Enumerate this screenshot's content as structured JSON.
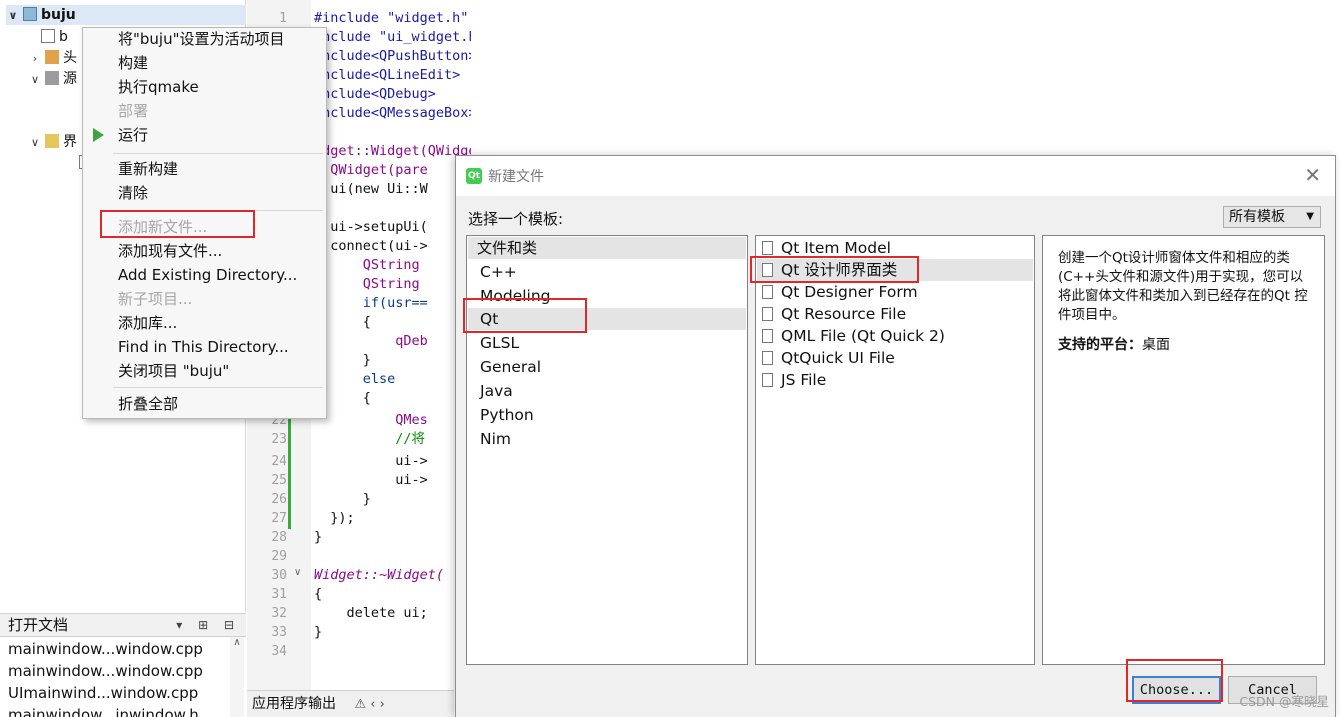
{
  "tree": {
    "root": "buju",
    "rows": [
      "b",
      "头",
      "源",
      "界"
    ]
  },
  "open_docs": {
    "title": "打开文档",
    "controls": "▾ ⊞ ⊟",
    "items": [
      "mainwindow...window.cpp",
      "mainwindow...window.cpp",
      "UImainwind...window.cpp",
      "mainwindow...inwindow.h"
    ]
  },
  "editor": {
    "line_numbers_top": [
      "1"
    ],
    "line_numbers_bottom": [
      "22",
      "23",
      "24",
      "25",
      "26",
      "27",
      "28",
      "29",
      "30",
      "31",
      "32",
      "33",
      "34"
    ],
    "code": {
      "l1": "#include \"widget.h\"",
      "l2": "include \"ui_widget.h\"",
      "l3": "include<QPushButton>",
      "l4": "include<QLineEdit>",
      "l5": "include<QDebug>",
      "l6": "include<QMessageBox>",
      "l8": "idget::Widget(QWidget *parent) :",
      "l9": "  QWidget(pare",
      "l10": "  ui(new Ui::W",
      "l12": "  ui->setupUi(",
      "l13": "  connect(ui->",
      "l14": "      QString",
      "l15": "      QString",
      "l16": "      if(usr==",
      "l17": "      {",
      "l18": "          qDeb",
      "l19": "      }",
      "l20": "      else",
      "l21": "      {",
      "l22": "          QMes",
      "l23": "          //将",
      "l24": "          ui->",
      "l25": "          ui->",
      "l26": "      }",
      "l27": "  });",
      "l28": "}",
      "l30": "Widget::~Widget(",
      "l31": "{",
      "l32": "    delete ui;",
      "l33": "}"
    }
  },
  "output_bar": {
    "label": "应用程序输出",
    "icons": "⚠  ‹  ›"
  },
  "context_menu": {
    "items": [
      {
        "label": "将\"buju\"设置为活动项目",
        "enabled": true
      },
      {
        "label": "构建",
        "enabled": true
      },
      {
        "label": "执行qmake",
        "enabled": true
      },
      {
        "label": "部署",
        "enabled": false
      },
      {
        "label": "运行",
        "enabled": true
      },
      {
        "label": "重新构建",
        "enabled": true
      },
      {
        "label": "清除",
        "enabled": true
      },
      {
        "label": "添加新文件...",
        "enabled": false
      },
      {
        "label": "添加现有文件...",
        "enabled": true
      },
      {
        "label": "Add Existing Directory...",
        "enabled": true
      },
      {
        "label": "新子项目...",
        "enabled": false
      },
      {
        "label": "添加库...",
        "enabled": true
      },
      {
        "label": "Find in This Directory...",
        "enabled": true
      },
      {
        "label": "关闭项目 \"buju\"",
        "enabled": true
      },
      {
        "label": "折叠全部",
        "enabled": true
      }
    ]
  },
  "dialog": {
    "title": "新建文件",
    "close": "✕",
    "template_label": "选择一个模板:",
    "filter_value": "所有模板",
    "category_header": "文件和类",
    "categories": [
      "C++",
      "Modeling",
      "Qt",
      "GLSL",
      "General",
      "Java",
      "Python",
      "Nim"
    ],
    "selected_category": "Qt",
    "templates": [
      "Qt Item Model",
      "Qt 设计师界面类",
      "Qt Designer Form",
      "Qt Resource File",
      "QML File (Qt Quick 2)",
      "QtQuick UI File",
      "JS File"
    ],
    "selected_template": "Qt 设计师界面类",
    "description": "创建一个Qt设计师窗体文件和相应的类(C++头文件和源文件)用于实现，您可以将此窗体文件和类加入到已经存在的Qt 控件项目中。",
    "platform_label": "支持的平台：",
    "platform_value": "桌面",
    "choose_label": "Choose...",
    "cancel_label": "Cancel"
  },
  "watermark": "CSDN @寒晓星",
  "colors": {
    "annotation_red": "#e02828",
    "selection": "#dce8f6",
    "run_green": "#3fa33f",
    "qt_green": "#41cd52"
  }
}
